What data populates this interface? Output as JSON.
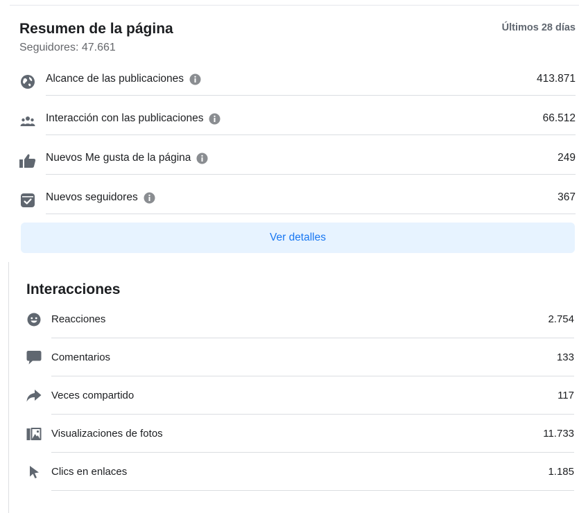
{
  "summary": {
    "title": "Resumen de la página",
    "followers": "Seguidores: 47.661",
    "range": "Últimos 28 días",
    "metrics": [
      {
        "icon": "globe-icon",
        "label": "Alcance de las publicaciones",
        "value": "413.871"
      },
      {
        "icon": "people-icon",
        "label": "Interacción con las publicaciones",
        "value": "66.512"
      },
      {
        "icon": "thumbs-up-icon",
        "label": "Nuevos Me gusta de la página",
        "value": "249"
      },
      {
        "icon": "follow-check-icon",
        "label": "Nuevos seguidores",
        "value": "367"
      }
    ],
    "details_button": "Ver detalles"
  },
  "interactions": {
    "title": "Interacciones",
    "items": [
      {
        "icon": "smiley-icon",
        "label": "Reacciones",
        "value": "2.754"
      },
      {
        "icon": "comment-icon",
        "label": "Comentarios",
        "value": "133"
      },
      {
        "icon": "share-arrow-icon",
        "label": "Veces compartido",
        "value": "117"
      },
      {
        "icon": "photo-icon",
        "label": "Visualizaciones de fotos",
        "value": "11.733"
      },
      {
        "icon": "cursor-icon",
        "label": "Clics en enlaces",
        "value": "1.185"
      }
    ]
  },
  "colors": {
    "primary_text": "#1c1e21",
    "secondary_text": "#65676b",
    "icon_gray": "#606770",
    "button_bg": "#e7f3ff",
    "button_text": "#1877f2",
    "divider": "#dadde1"
  }
}
